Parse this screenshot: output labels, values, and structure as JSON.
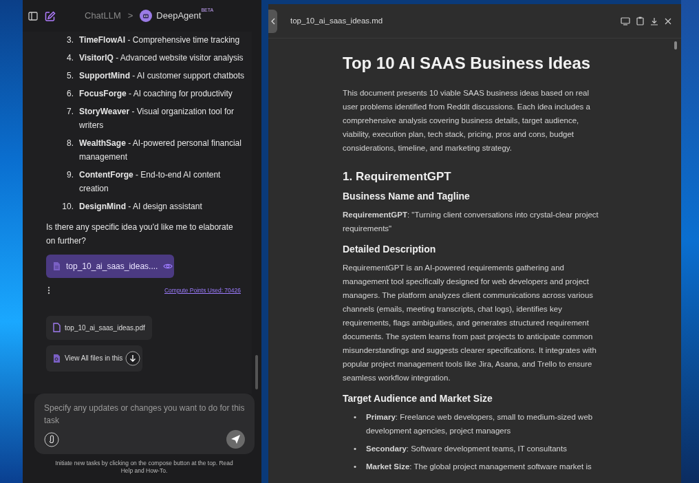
{
  "header": {
    "breadcrumb_root": "ChatLLM",
    "separator": ">",
    "agent": "DeepAgent",
    "badge": "BETA"
  },
  "chat": {
    "ideas": [
      {
        "number": "3.",
        "name": "TimeFlowAI",
        "description": " - Comprehensive time tracking"
      },
      {
        "number": "4.",
        "name": "VisitorIQ",
        "description": " - Advanced website visitor analysis"
      },
      {
        "number": "5.",
        "name": "SupportMind",
        "description": " - AI customer support chatbots"
      },
      {
        "number": "6.",
        "name": "FocusForge",
        "description": " - AI coaching for productivity"
      },
      {
        "number": "7.",
        "name": "StoryWeaver",
        "description": " - Visual organization tool for writers"
      },
      {
        "number": "8.",
        "name": "WealthSage",
        "description": " - AI-powered personal financial management"
      },
      {
        "number": "9.",
        "name": "ContentForge",
        "description": " - End-to-end AI content creation"
      },
      {
        "number": "10.",
        "name": "DesignMind",
        "description": " - AI design assistant"
      }
    ],
    "question": "Is there any specific idea you'd like me to elaborate on further?",
    "attachment": {
      "name": "top_10_ai_saas_ideas....",
      "selected": true
    },
    "compute_points": "Compute Points Used: 70426",
    "files": [
      {
        "kind": "file",
        "name": "top_10_ai_saas_ideas.pdf"
      },
      {
        "kind": "folder",
        "name": "View All files in this"
      }
    ],
    "compose_placeholder": "Specify any updates or changes you want to do for this task",
    "footer_text": "Initiate new tasks by clicking on the compose button at the top. Read",
    "footer_link": "Help and How-To."
  },
  "document": {
    "filename": "top_10_ai_saas_ideas.md",
    "title": "Top 10 AI SAAS Business Ideas",
    "blocks": [
      {
        "kind": "p",
        "text": "This document presents 10 viable SAAS business ideas based on real user problems identified from Reddit discussions. Each idea includes a comprehensive analysis covering business details, target audience, viability, execution plan, tech stack, pricing, pros and cons, budget considerations, timeline, and marketing strategy."
      },
      {
        "kind": "h2",
        "text": "1. RequirementGPT"
      },
      {
        "kind": "h3",
        "text": "Business Name and Tagline"
      },
      {
        "kind": "p",
        "text": "**RequirementGPT**: \"Turning client conversations into crystal-clear project requirements\""
      },
      {
        "kind": "h3",
        "text": "Detailed Description"
      },
      {
        "kind": "p",
        "text": "RequirementGPT is an AI-powered requirements gathering and management tool specifically designed for web developers and project managers. The platform analyzes client communications across various channels (emails, meeting transcripts, chat logs), identifies key requirements, flags ambiguities, and generates structured requirement documents. The system learns from past projects to anticipate common misunderstandings and suggests clearer specifications. It integrates with popular project management tools like Jira, Asana, and Trello to ensure seamless workflow integration."
      },
      {
        "kind": "h3",
        "text": "Target Audience and Market Size"
      },
      {
        "kind": "bullets",
        "items": [
          {
            "marker": "•",
            "text": "**Primary**: Freelance web developers, small to medium-sized web development agencies, project managers"
          },
          {
            "marker": "•",
            "text": "**Secondary**: Software development teams, IT consultants"
          },
          {
            "marker": "•",
            "text": "**Market Size**: The global project management software market is"
          }
        ]
      }
    ]
  }
}
